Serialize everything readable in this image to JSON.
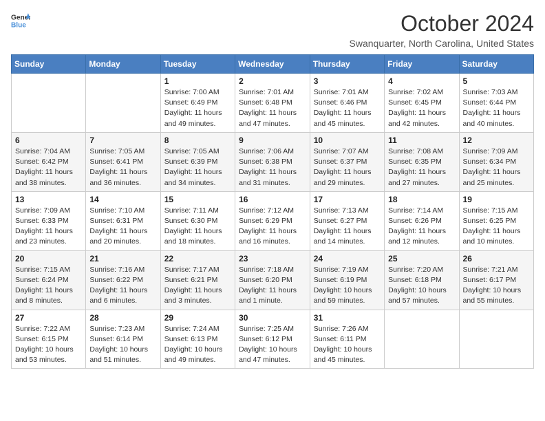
{
  "header": {
    "logo_line1": "General",
    "logo_line2": "Blue",
    "month_title": "October 2024",
    "location": "Swanquarter, North Carolina, United States"
  },
  "weekdays": [
    "Sunday",
    "Monday",
    "Tuesday",
    "Wednesday",
    "Thursday",
    "Friday",
    "Saturday"
  ],
  "weeks": [
    [
      {
        "day": "",
        "info": ""
      },
      {
        "day": "",
        "info": ""
      },
      {
        "day": "1",
        "info": "Sunrise: 7:00 AM\nSunset: 6:49 PM\nDaylight: 11 hours and 49 minutes."
      },
      {
        "day": "2",
        "info": "Sunrise: 7:01 AM\nSunset: 6:48 PM\nDaylight: 11 hours and 47 minutes."
      },
      {
        "day": "3",
        "info": "Sunrise: 7:01 AM\nSunset: 6:46 PM\nDaylight: 11 hours and 45 minutes."
      },
      {
        "day": "4",
        "info": "Sunrise: 7:02 AM\nSunset: 6:45 PM\nDaylight: 11 hours and 42 minutes."
      },
      {
        "day": "5",
        "info": "Sunrise: 7:03 AM\nSunset: 6:44 PM\nDaylight: 11 hours and 40 minutes."
      }
    ],
    [
      {
        "day": "6",
        "info": "Sunrise: 7:04 AM\nSunset: 6:42 PM\nDaylight: 11 hours and 38 minutes."
      },
      {
        "day": "7",
        "info": "Sunrise: 7:05 AM\nSunset: 6:41 PM\nDaylight: 11 hours and 36 minutes."
      },
      {
        "day": "8",
        "info": "Sunrise: 7:05 AM\nSunset: 6:39 PM\nDaylight: 11 hours and 34 minutes."
      },
      {
        "day": "9",
        "info": "Sunrise: 7:06 AM\nSunset: 6:38 PM\nDaylight: 11 hours and 31 minutes."
      },
      {
        "day": "10",
        "info": "Sunrise: 7:07 AM\nSunset: 6:37 PM\nDaylight: 11 hours and 29 minutes."
      },
      {
        "day": "11",
        "info": "Sunrise: 7:08 AM\nSunset: 6:35 PM\nDaylight: 11 hours and 27 minutes."
      },
      {
        "day": "12",
        "info": "Sunrise: 7:09 AM\nSunset: 6:34 PM\nDaylight: 11 hours and 25 minutes."
      }
    ],
    [
      {
        "day": "13",
        "info": "Sunrise: 7:09 AM\nSunset: 6:33 PM\nDaylight: 11 hours and 23 minutes."
      },
      {
        "day": "14",
        "info": "Sunrise: 7:10 AM\nSunset: 6:31 PM\nDaylight: 11 hours and 20 minutes."
      },
      {
        "day": "15",
        "info": "Sunrise: 7:11 AM\nSunset: 6:30 PM\nDaylight: 11 hours and 18 minutes."
      },
      {
        "day": "16",
        "info": "Sunrise: 7:12 AM\nSunset: 6:29 PM\nDaylight: 11 hours and 16 minutes."
      },
      {
        "day": "17",
        "info": "Sunrise: 7:13 AM\nSunset: 6:27 PM\nDaylight: 11 hours and 14 minutes."
      },
      {
        "day": "18",
        "info": "Sunrise: 7:14 AM\nSunset: 6:26 PM\nDaylight: 11 hours and 12 minutes."
      },
      {
        "day": "19",
        "info": "Sunrise: 7:15 AM\nSunset: 6:25 PM\nDaylight: 11 hours and 10 minutes."
      }
    ],
    [
      {
        "day": "20",
        "info": "Sunrise: 7:15 AM\nSunset: 6:24 PM\nDaylight: 11 hours and 8 minutes."
      },
      {
        "day": "21",
        "info": "Sunrise: 7:16 AM\nSunset: 6:22 PM\nDaylight: 11 hours and 6 minutes."
      },
      {
        "day": "22",
        "info": "Sunrise: 7:17 AM\nSunset: 6:21 PM\nDaylight: 11 hours and 3 minutes."
      },
      {
        "day": "23",
        "info": "Sunrise: 7:18 AM\nSunset: 6:20 PM\nDaylight: 11 hours and 1 minute."
      },
      {
        "day": "24",
        "info": "Sunrise: 7:19 AM\nSunset: 6:19 PM\nDaylight: 10 hours and 59 minutes."
      },
      {
        "day": "25",
        "info": "Sunrise: 7:20 AM\nSunset: 6:18 PM\nDaylight: 10 hours and 57 minutes."
      },
      {
        "day": "26",
        "info": "Sunrise: 7:21 AM\nSunset: 6:17 PM\nDaylight: 10 hours and 55 minutes."
      }
    ],
    [
      {
        "day": "27",
        "info": "Sunrise: 7:22 AM\nSunset: 6:15 PM\nDaylight: 10 hours and 53 minutes."
      },
      {
        "day": "28",
        "info": "Sunrise: 7:23 AM\nSunset: 6:14 PM\nDaylight: 10 hours and 51 minutes."
      },
      {
        "day": "29",
        "info": "Sunrise: 7:24 AM\nSunset: 6:13 PM\nDaylight: 10 hours and 49 minutes."
      },
      {
        "day": "30",
        "info": "Sunrise: 7:25 AM\nSunset: 6:12 PM\nDaylight: 10 hours and 47 minutes."
      },
      {
        "day": "31",
        "info": "Sunrise: 7:26 AM\nSunset: 6:11 PM\nDaylight: 10 hours and 45 minutes."
      },
      {
        "day": "",
        "info": ""
      },
      {
        "day": "",
        "info": ""
      }
    ]
  ]
}
